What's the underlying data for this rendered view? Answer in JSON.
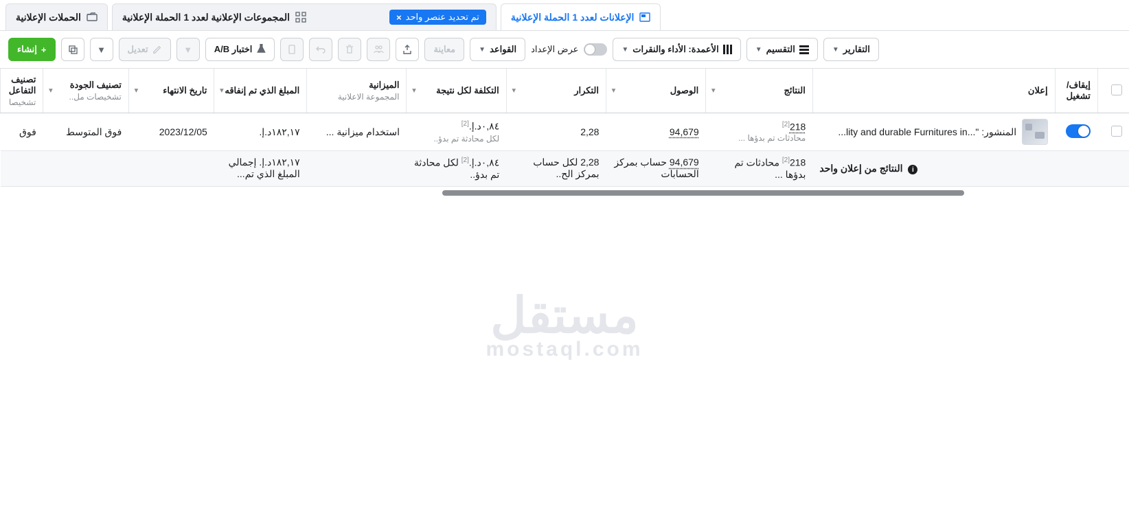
{
  "tabs": {
    "campaigns": {
      "label": "الحملات الإعلانية"
    },
    "adsets": {
      "label": "المجموعات الإعلانية لعدد 1 الحملة الإعلانية"
    },
    "ads": {
      "label": "الإعلانات لعدد 1 الحملة الإعلانية"
    },
    "selection_chip": {
      "text": "تم تحديد عنصر واحد",
      "close": "×"
    }
  },
  "toolbar": {
    "create": "إنشاء",
    "plus": "+",
    "duplicate_tooltip": "نسخ",
    "edit": "تعديل",
    "ab_test": "اختبار A/B",
    "preview": "معاينة",
    "rules": "القواعد",
    "view_setup": "عرض الإعداد",
    "columns": "الأعمدة: الأداء والنقرات",
    "breakdown": "التقسيم",
    "reports": "التقارير"
  },
  "columns": {
    "checkbox": "",
    "toggle": "إيقاف/\nتشغيل",
    "ad": "إعلان",
    "results": "النتائج",
    "reach": "الوصول",
    "frequency": "التكرار",
    "cost_per_result": "التكلفة لكل نتيجة",
    "budget": "الميزانية",
    "budget_sub": "المجموعة الاعلانية",
    "spent": "المبلغ الذي تم إنفاقه",
    "end_date": "تاريخ الانتهاء",
    "quality": "تصنيف الجودة",
    "quality_sub": "تشخيصات مل..",
    "engagement": "تصنيف التفاعل",
    "engagement_sub": "تشخيصا"
  },
  "row": {
    "ad_prefix": "المنشور: \"",
    "ad_title": "...lity and durable Furnitures in...",
    "results_value": "218",
    "results_sup": "[2]",
    "results_sub": "محادثات تم بدؤها ...",
    "reach": "94,679",
    "frequency": "2,28",
    "cost_value": "٠,٨٤د.إ.",
    "cost_sup": "[2]",
    "cost_sub": "لكل محادثة تم بدؤ..",
    "budget": "استخدام ميزانية ...",
    "spent": "١٨٢,١٧د.إ.",
    "end_date": "2023/12/05",
    "quality": "فوق المتوسط",
    "engagement": "فوق"
  },
  "footer": {
    "label": "النتائج من إعلان واحد",
    "results_value": "218",
    "results_sup": "[2]",
    "results_sub": "محادثات تم بدؤها ...",
    "reach": "94,679",
    "reach_sub": "حساب بمركز الحسابات",
    "frequency": "2,28",
    "frequency_sub": "لكل حساب بمركز الح..",
    "cost_value": "٠,٨٤د.إ.",
    "cost_sup": "[2]",
    "cost_sub": "لكل محادثة تم بدؤ..",
    "spent": "١٨٢,١٧د.إ.",
    "spent_sub": "إجمالي المبلغ الذي تم..."
  },
  "watermark": {
    "ar": "مستقل",
    "en": "mostaql.com"
  }
}
